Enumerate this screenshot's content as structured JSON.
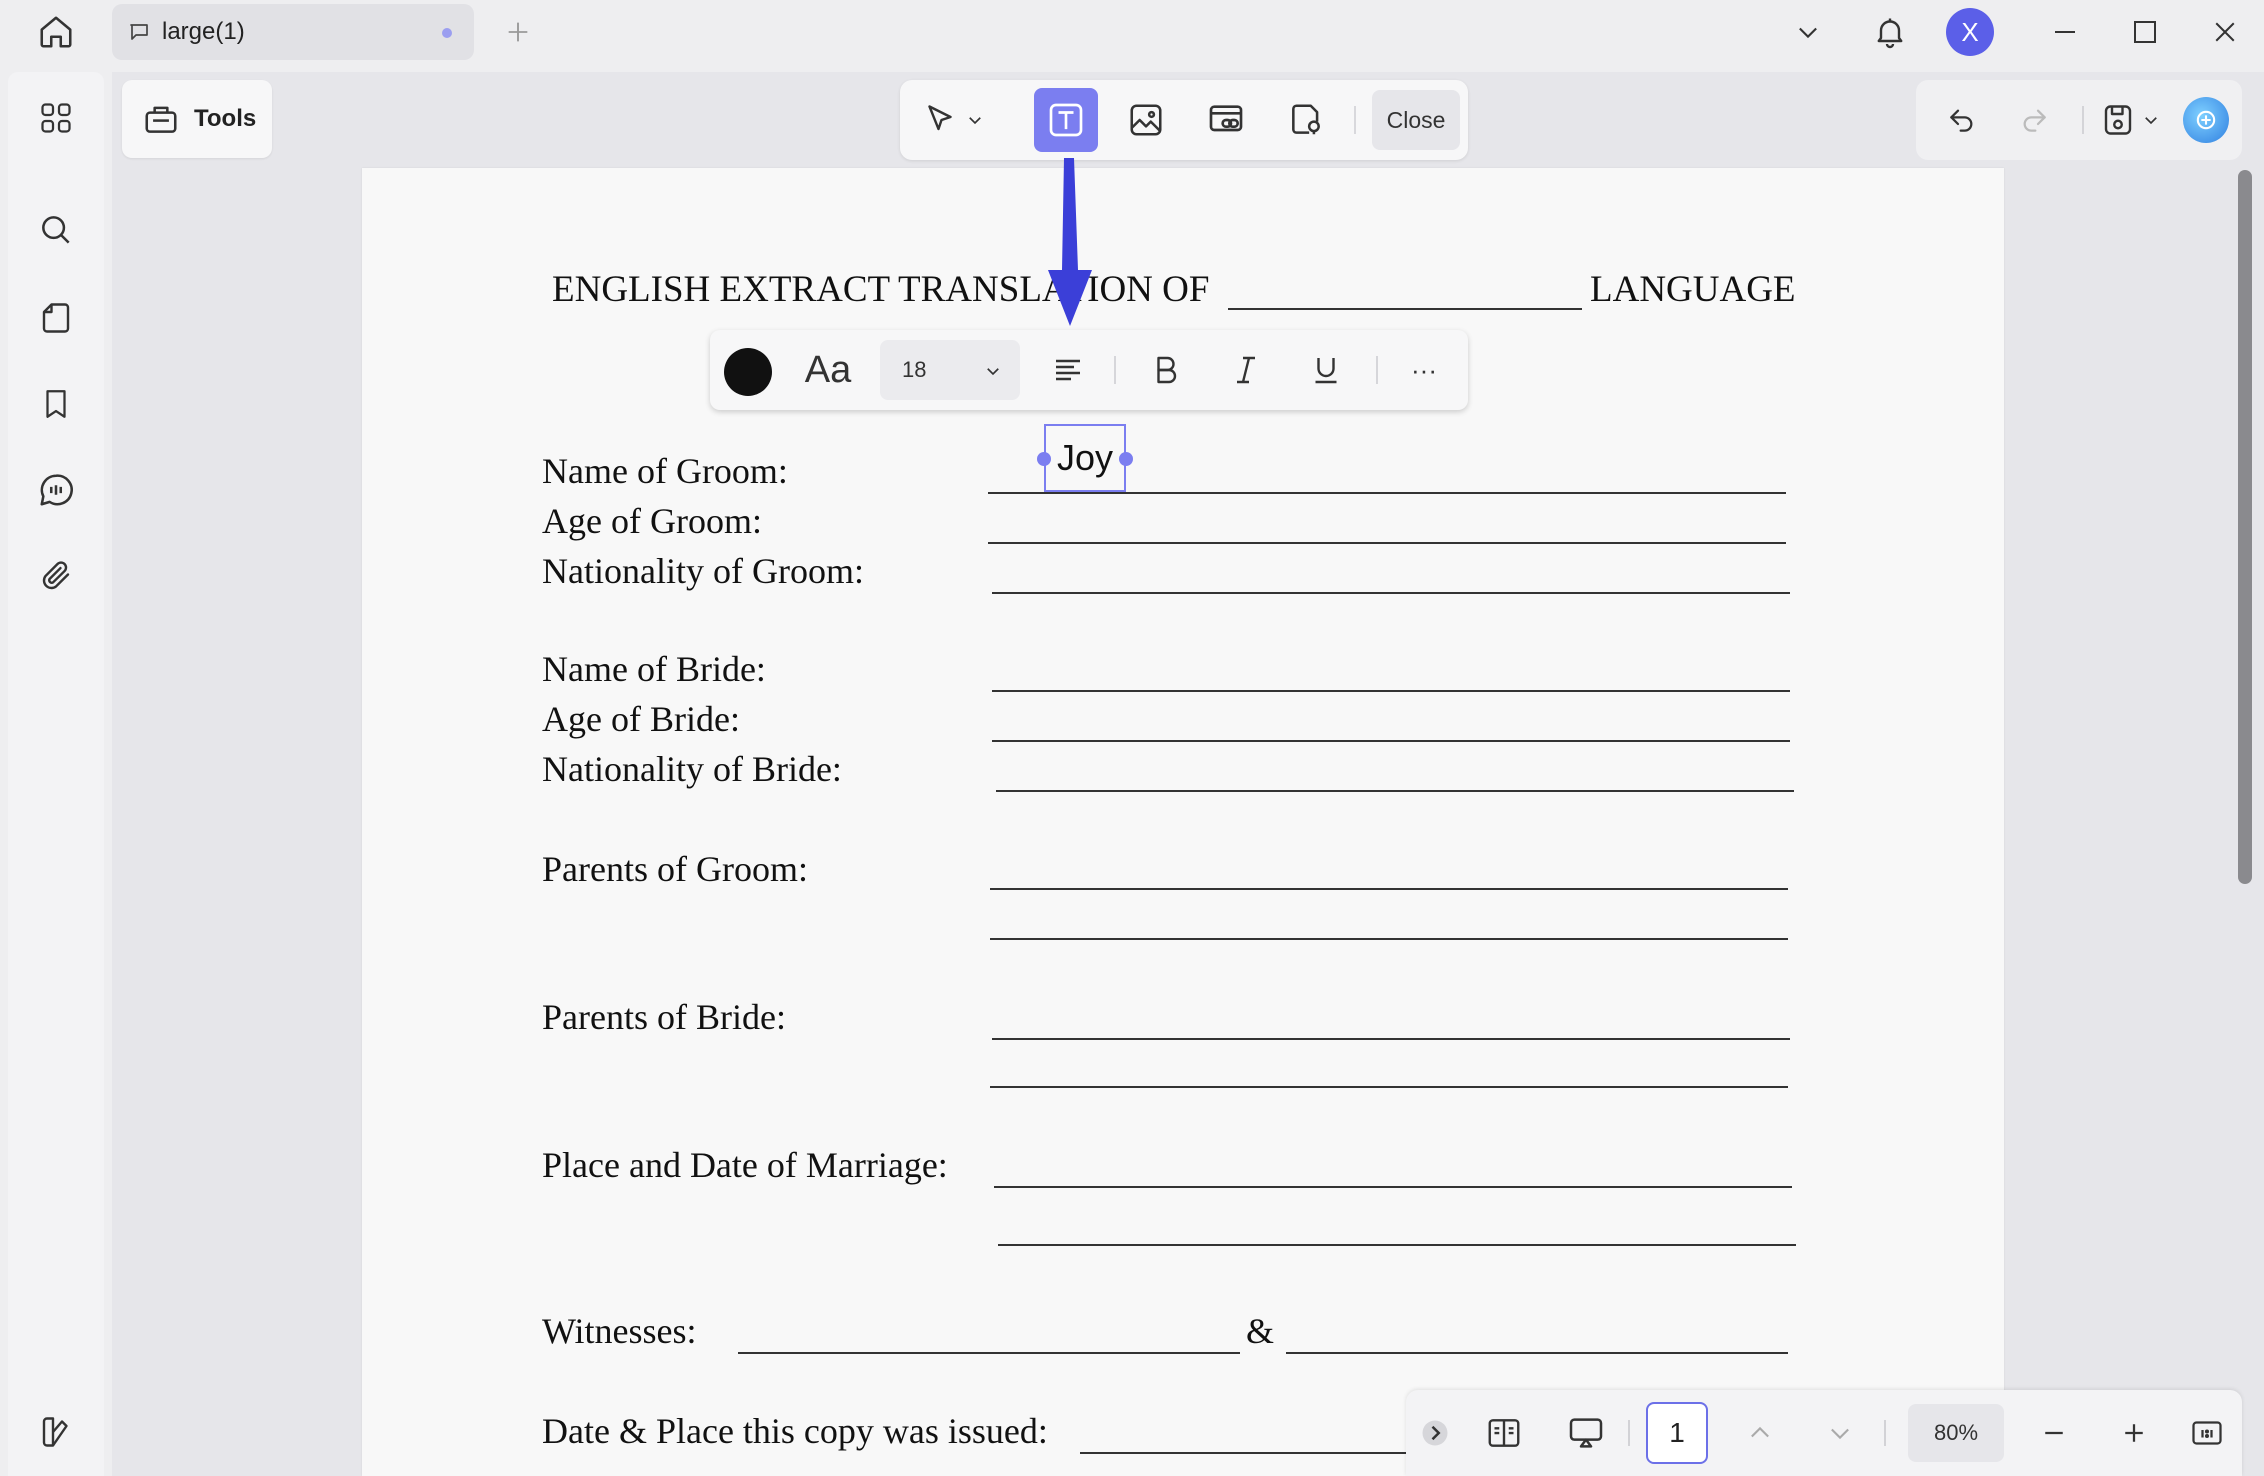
{
  "titlebar": {
    "tab_title": "large(1)",
    "avatar_letter": "X"
  },
  "tools": {
    "label": "Tools"
  },
  "toolbar": {
    "close_label": "Close"
  },
  "format_bar": {
    "font_size": "18",
    "font_label": "Aa",
    "more_label": "···"
  },
  "document": {
    "title_text": "ENGLISH EXTRACT TRANSLATION OF",
    "title_suffix": "LANGUAGE",
    "fields": {
      "name_groom": "Name of Groom:",
      "age_groom": "Age of Groom:",
      "nationality_groom": "Nationality of Groom:",
      "name_bride": "Name of Bride:",
      "age_bride": "Age of Bride:",
      "nationality_bride": "Nationality of Bride:",
      "parents_groom": "Parents of Groom:",
      "parents_bride": "Parents of Bride:",
      "place_date": "Place and Date of Marriage:",
      "witnesses": "Witnesses:",
      "witness_amp": "&",
      "date_place_issued": "Date & Place this copy was issued:"
    },
    "textbox_value": "Joy"
  },
  "bottom_bar": {
    "page_number": "1",
    "zoom": "80%"
  },
  "colors": {
    "accent": "#7b7ef0",
    "avatar": "#5b5fe8",
    "arrow": "#3b3fd8",
    "text_color_swatch": "#111111"
  }
}
